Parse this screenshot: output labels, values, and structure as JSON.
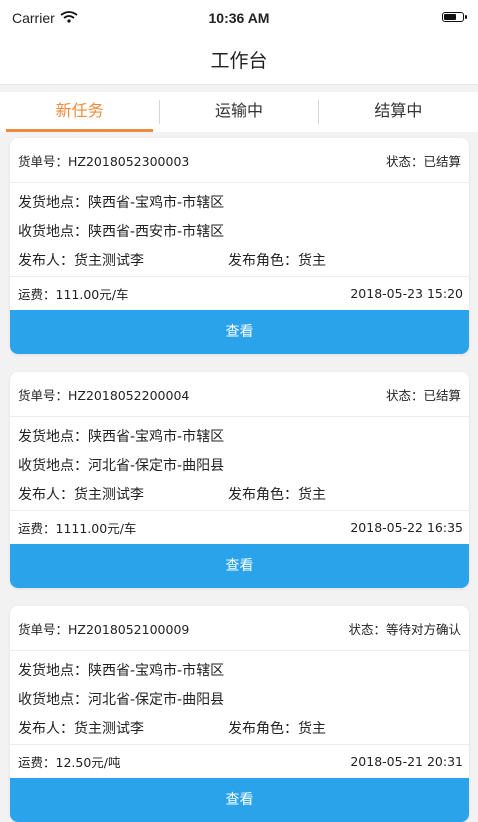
{
  "statusbar": {
    "carrier": "Carrier",
    "time": "10:36 AM",
    "battery_level": 0.7
  },
  "navbar": {
    "title": "工作台"
  },
  "tabs": [
    {
      "label": "新任务",
      "active": true
    },
    {
      "label": "运输中",
      "active": false
    },
    {
      "label": "结算中",
      "active": false
    }
  ],
  "cards": [
    {
      "order_no": "货单号：HZ2018052300003",
      "status": "状态：已结算",
      "from": "发货地点：陕西省-宝鸡市-市辖区",
      "to": "收货地点：陕西省-西安市-市辖区",
      "publisher": "发布人：货主测试李",
      "role": "发布角色：货主",
      "fee": "运费：111.00元/车",
      "date": "2018-05-23 15:20",
      "button": "查看"
    },
    {
      "order_no": "货单号：HZ2018052200004",
      "status": "状态：已结算",
      "from": "发货地点：陕西省-宝鸡市-市辖区",
      "to": "收货地点：河北省-保定市-曲阳县",
      "publisher": "发布人：货主测试李",
      "role": "发布角色：货主",
      "fee": "运费：1111.00元/车",
      "date": "2018-05-22 16:35",
      "button": "查看"
    },
    {
      "order_no": "货单号：HZ2018052100009",
      "status": "状态：等待对方确认",
      "from": "发货地点：陕西省-宝鸡市-市辖区",
      "to": "收货地点：河北省-保定市-曲阳县",
      "publisher": "发布人：货主测试李",
      "role": "发布角色：货主",
      "fee": "运费：12.50元/吨",
      "date": "2018-05-21 20:31",
      "button": "查看"
    }
  ],
  "colors": {
    "accent": "#f08a3c",
    "button": "#2aa3ea"
  }
}
